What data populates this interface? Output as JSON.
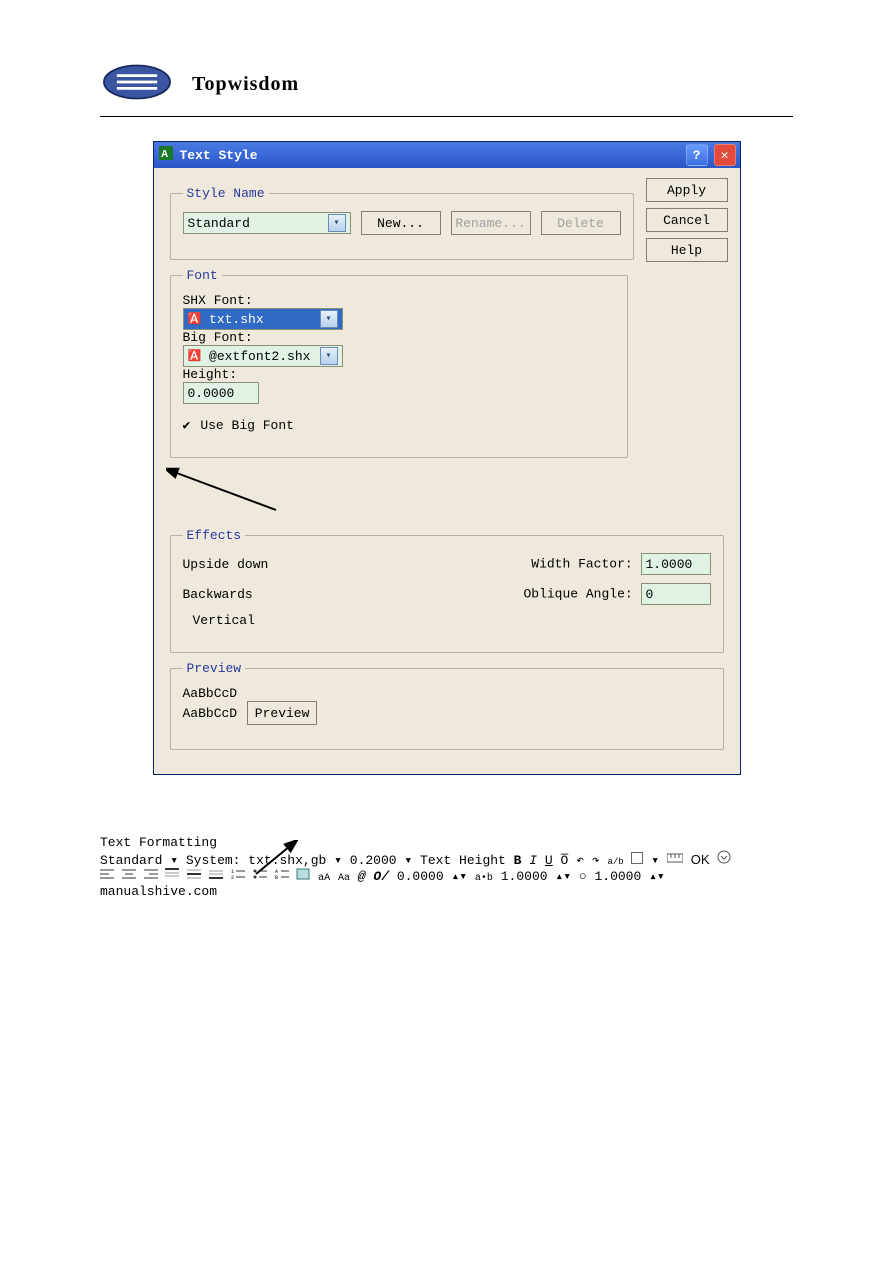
{
  "doc_header": {
    "brand": "Topwisdom"
  },
  "dialog": {
    "title": "Text Style",
    "style_name": {
      "legend": "Style Name",
      "value": "Standard",
      "new_btn": "New...",
      "rename_btn": "Rename...",
      "delete_btn": "Delete"
    },
    "side": {
      "apply": "Apply",
      "cancel": "Cancel",
      "help": "Help"
    },
    "font": {
      "legend": "Font",
      "shx_label": "SHX Font:",
      "shx_value": "txt.shx",
      "big_label": "Big Font:",
      "big_value": "@extfont2.shx",
      "height_label": "Height:",
      "height_value": "0.0000",
      "use_big_font": "Use Big Font"
    },
    "effects": {
      "legend": "Effects",
      "upside_down": "Upside down",
      "backwards": "Backwards",
      "vertical": "Vertical",
      "width_factor_label": "Width Factor:",
      "width_factor_value": "1.0000",
      "oblique_label": "Oblique Angle:",
      "oblique_value": "0"
    },
    "preview": {
      "legend": "Preview",
      "sample_big": "AaBbCcD",
      "sample_field": "AaBbCcD",
      "preview_btn": "Preview"
    }
  },
  "toolbar": {
    "title": "Text Formatting",
    "style_value": "Standard",
    "font_value": "System: txt.shx,gb",
    "height_value": "0.2000",
    "tooltip": "Text Height",
    "bold": "B",
    "italic": "I",
    "underline": "U",
    "overline": "O̅",
    "fraction": "a/b",
    "ok": "OK",
    "row2": {
      "at": "@",
      "oblique_label": "O/",
      "oblique_value": "0.0000",
      "tracking_label": "a•b",
      "tracking_value": "1.0000",
      "width_icon": "○",
      "width_value": "1.0000",
      "aA": "aA",
      "Aa": "Aa"
    }
  },
  "watermark": "manualshive.com"
}
